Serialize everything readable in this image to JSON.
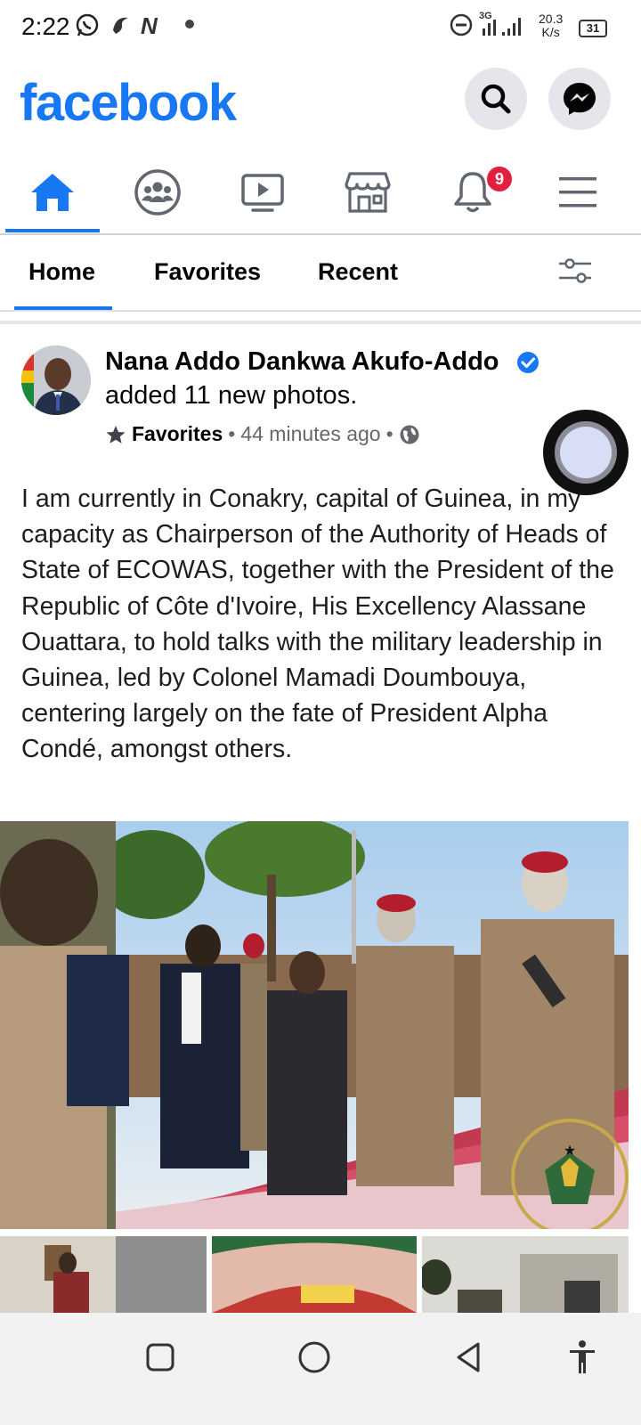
{
  "status_bar": {
    "time": "2:22",
    "net_speed_value": "20.3",
    "net_speed_unit": "K/s",
    "battery": "31",
    "network_label": "3G",
    "notification_letter": "N",
    "icons": [
      "whatsapp-icon",
      "swirl-app-icon",
      "n-app-icon",
      "dot-icon",
      "do-not-disturb-icon",
      "signal-icon",
      "battery-icon"
    ]
  },
  "header": {
    "logo": "facebook",
    "brand_color": "#1877f2"
  },
  "nav": {
    "items": [
      "home-icon",
      "groups-icon",
      "video-icon",
      "marketplace-icon",
      "notifications-icon",
      "menu-icon"
    ],
    "notification_count": "9"
  },
  "tabs": {
    "items": [
      {
        "label": "Home",
        "active": true
      },
      {
        "label": "Favorites",
        "active": false
      },
      {
        "label": "Recent",
        "active": false
      }
    ]
  },
  "post": {
    "author": "Nana Addo Dankwa Akufo-Addo",
    "action": "added 11 new photos.",
    "favorites_label": "Favorites",
    "time": "44 minutes ago",
    "separator": "•",
    "privacy": "public",
    "text": "I am currently in Conakry, capital of Guinea, in my capacity as Chairperson of the Authority of Heads of State of ECOWAS, together with the President of the Republic of Côte d'Ivoire, His Excellency Alassane Ouattara, to hold talks with the military leadership in Guinea, led by Colonel Mamadi Doumbouya, centering largely on the fate of President Alpha Condé, amongst others."
  },
  "android_nav": {
    "items": [
      "recent-apps-icon",
      "home-circle-icon",
      "back-icon",
      "accessibility-icon"
    ]
  }
}
